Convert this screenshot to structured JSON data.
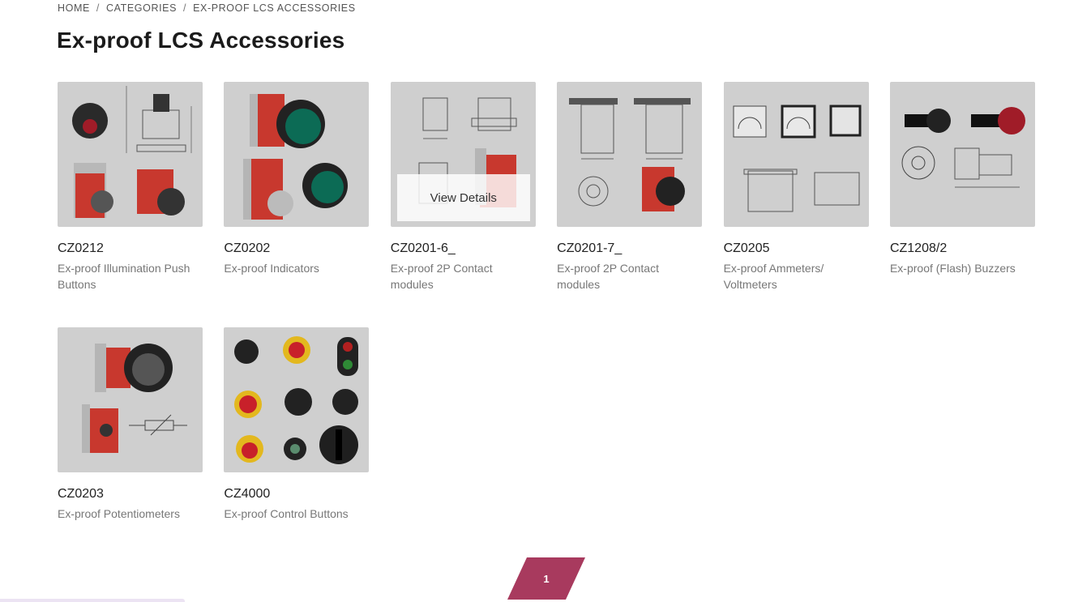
{
  "breadcrumb": {
    "items": [
      "HOME",
      "CATEGORIES",
      "EX-PROOF LCS ACCESSORIES"
    ],
    "separator": "/"
  },
  "page": {
    "title": "Ex-proof LCS Accessories"
  },
  "overlay": {
    "label": "View Details"
  },
  "products": [
    {
      "code": "CZ0212",
      "desc": "Ex-proof Illumination Push Buttons"
    },
    {
      "code": "CZ0202",
      "desc": "Ex-proof Indicators"
    },
    {
      "code": "CZ0201-6_",
      "desc": "Ex-proof 2P Contact modules"
    },
    {
      "code": "CZ0201-7_",
      "desc": "Ex-proof 2P Contact modules"
    },
    {
      "code": "CZ0205",
      "desc": "Ex-proof Ammeters/ Voltmeters"
    },
    {
      "code": "CZ1208/2",
      "desc": "Ex-proof (Flash) Buzzers"
    },
    {
      "code": "CZ0203",
      "desc": "Ex-proof Potentiometers"
    },
    {
      "code": "CZ4000",
      "desc": "Ex-proof Control Buttons"
    }
  ],
  "pagination": {
    "current": "1"
  },
  "colors": {
    "accent": "#a83a5e",
    "thumb_bg": "#cfcfcf",
    "desc_text": "#777777"
  }
}
